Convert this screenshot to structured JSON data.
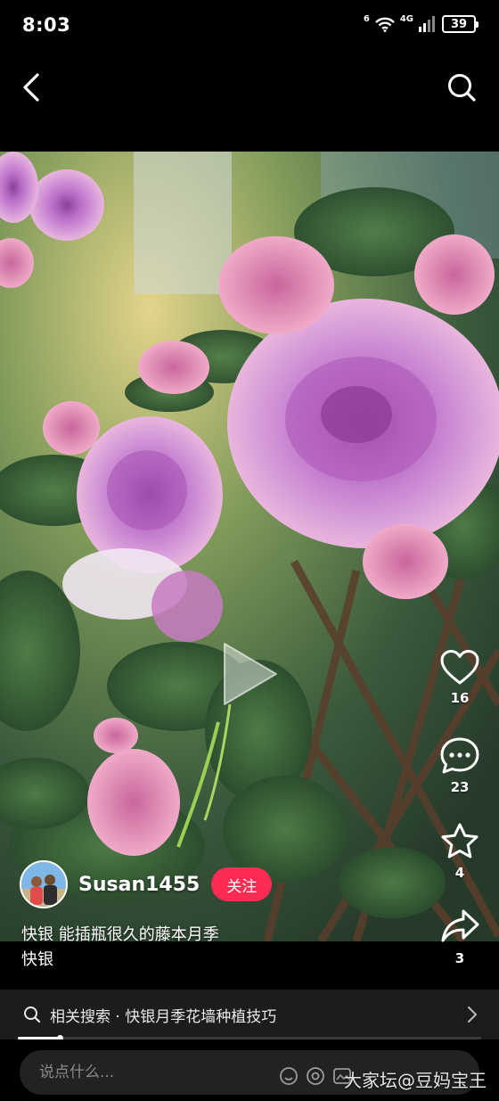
{
  "status": {
    "time": "8:03",
    "network": "4G",
    "wifi_label": "6",
    "battery": "39"
  },
  "nav": {
    "back_icon": "chevron-left-icon",
    "search_icon": "search-icon"
  },
  "video": {
    "state": "paused",
    "play_icon": "play-icon",
    "colors": {
      "rose": "#c48ad6",
      "leaf": "#3d6b3a",
      "background_blur": "#d8c27a"
    }
  },
  "actions": [
    {
      "name": "like",
      "icon": "heart-icon",
      "count": "16"
    },
    {
      "name": "comment",
      "icon": "comment-icon",
      "count": "23"
    },
    {
      "name": "favorite",
      "icon": "star-icon",
      "count": "4"
    },
    {
      "name": "share",
      "icon": "share-icon",
      "count": "3"
    }
  ],
  "author": {
    "name": "Susan1455",
    "follow_label": "关注",
    "avatar_icon": "avatar"
  },
  "caption": {
    "line1": "快银 能插瓶很久的藤本月季",
    "line2": "快银"
  },
  "related": {
    "label": "相关搜索 · 快银月季花墙种植技巧",
    "icon": "search-icon",
    "chevron": "chevron-right-icon"
  },
  "progress": {
    "fraction": 0.09
  },
  "comment": {
    "placeholder": "说点什么..."
  },
  "watermark": {
    "text": "大家坛@豆妈宝王"
  },
  "colors": {
    "accent": "#fe2c55",
    "background": "#000000",
    "related_bg": "#1c1c1e"
  }
}
